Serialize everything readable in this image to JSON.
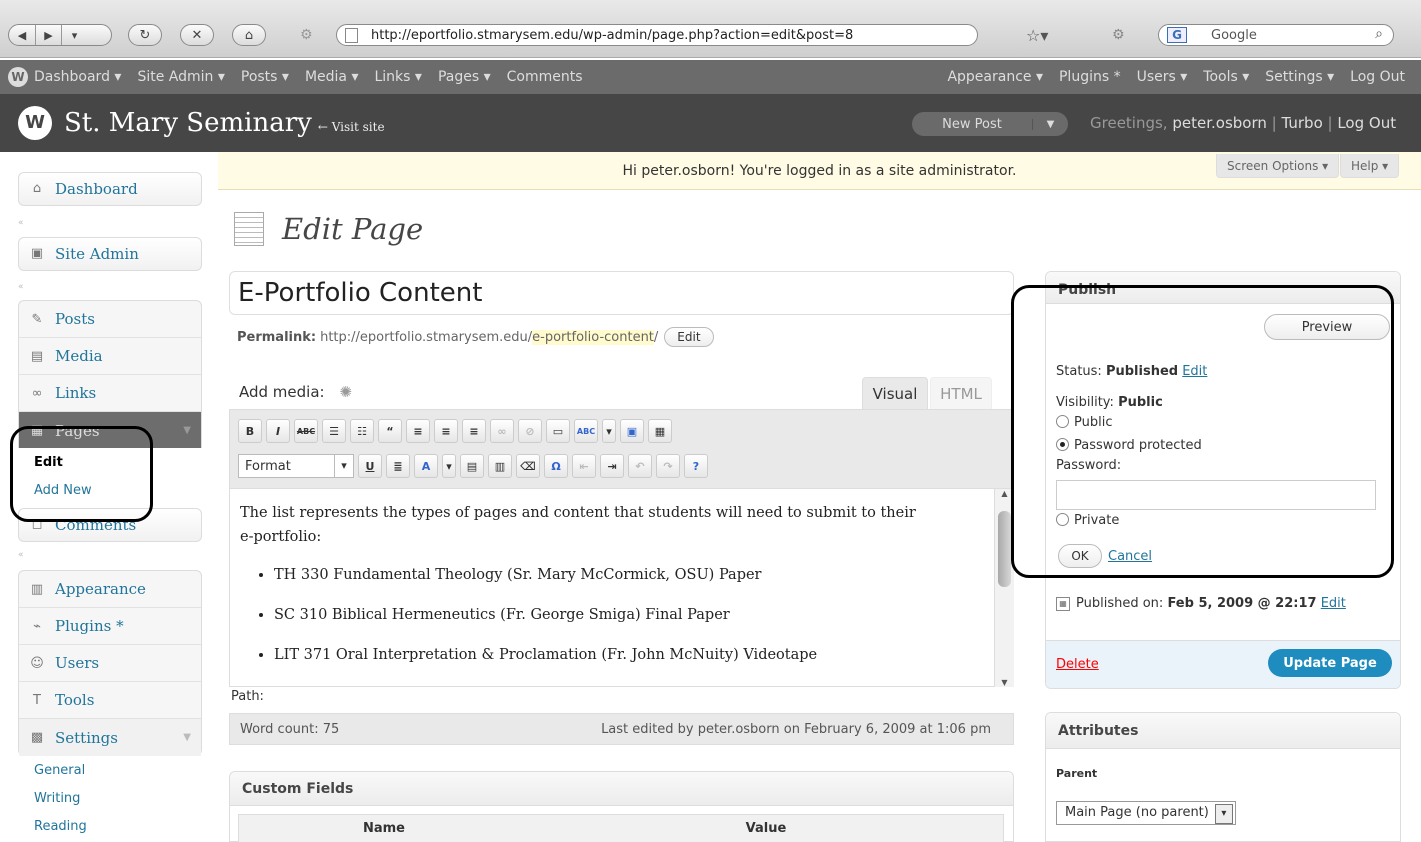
{
  "browser": {
    "url": "http://eportfolio.stmarysem.edu/wp-admin/page.php?action=edit&post=8",
    "search_placeholder": "Google"
  },
  "adminbar": {
    "left_items": [
      "Dashboard ▾",
      "Site Admin ▾",
      "Posts ▾",
      "Media ▾",
      "Links ▾",
      "Pages ▾",
      "Comments"
    ],
    "right_items": [
      "Appearance ▾",
      "Plugins *",
      "Users ▾",
      "Tools ▾",
      "Settings ▾",
      "Log Out"
    ]
  },
  "header": {
    "site_title": "St. Mary Seminary",
    "visit_site": "← Visit site",
    "new_post": "New Post",
    "greeting_prefix": "Greetings,",
    "username": "peter.osborn",
    "turbo": "Turbo",
    "logout": "Log Out"
  },
  "sidebar": {
    "dashboard": "Dashboard",
    "site_admin": "Site Admin",
    "posts": "Posts",
    "media": "Media",
    "links": "Links",
    "pages": "Pages",
    "pages_sub": [
      "Edit",
      "Add New"
    ],
    "comments": "Comments",
    "appearance": "Appearance",
    "plugins": "Plugins *",
    "users": "Users",
    "tools": "Tools",
    "settings": "Settings",
    "settings_sub": [
      "General",
      "Writing",
      "Reading"
    ]
  },
  "notice": "Hi peter.osborn! You're logged in as a site administrator.",
  "screen_options": "Screen Options ▾",
  "help": "Help ▾",
  "page": {
    "heading": "Edit Page",
    "title_value": "E-Portfolio Content",
    "permalink_label": "Permalink:",
    "permalink_base": "http://eportfolio.stmarysem.edu/",
    "permalink_slug": "e-portfolio-content",
    "permalink_tail": "/",
    "permalink_edit": "Edit",
    "add_media": "Add media:",
    "tab_visual": "Visual",
    "tab_html": "HTML",
    "format": "Format",
    "intro_line1": "The list represents the types of pages and content that students will need to submit to their",
    "intro_line2": "e-portfolio:",
    "items": [
      "TH 330 Fundamental Theology (Sr. Mary McCormick, OSU) Paper",
      "SC 310 Biblical Hermeneutics (Fr. George Smiga) Final Paper",
      "LIT 371 Oral Interpretation & Proclamation (Fr. John McNuity) Videotape"
    ],
    "path": "Path:",
    "word_count": "Word count: 75",
    "last_edited": "Last edited by peter.osborn on February 6, 2009 at 1:06 pm",
    "custom_fields": "Custom Fields",
    "cf_name": "Name",
    "cf_value": "Value"
  },
  "publish": {
    "heading": "Publish",
    "preview": "Preview",
    "status_label": "Status:",
    "status_value": "Published",
    "status_edit": "Edit",
    "visibility_label": "Visibility:",
    "visibility_value": "Public",
    "opt_public": "Public",
    "opt_password": "Password protected",
    "password_label": "Password:",
    "opt_private": "Private",
    "ok": "OK",
    "cancel": "Cancel",
    "published_on_label": "Published on:",
    "published_on_value": "Feb 5, 2009 @ 22:17",
    "published_edit": "Edit",
    "delete": "Delete",
    "update": "Update Page"
  },
  "attributes": {
    "heading": "Attributes",
    "parent_label": "Parent",
    "parent_value": "Main Page (no parent)"
  }
}
